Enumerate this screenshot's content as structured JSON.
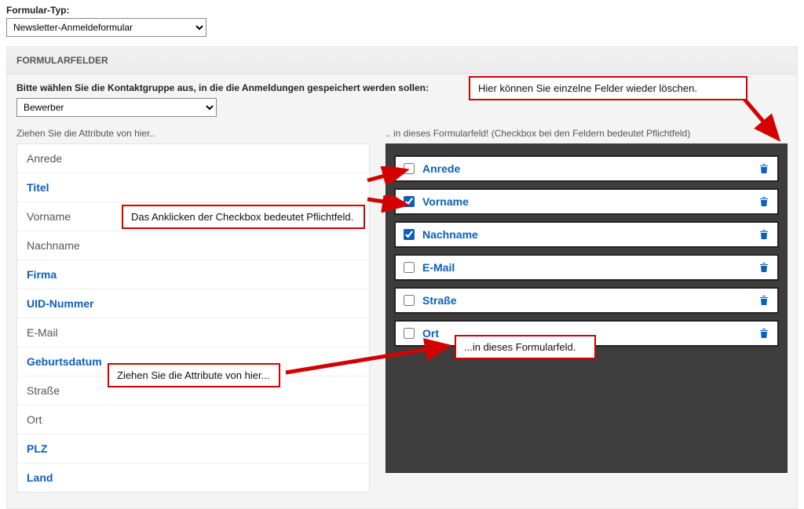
{
  "top": {
    "label": "Formular-Typ:",
    "selected": "Newsletter-Anmeldeformular"
  },
  "section": {
    "title": "FORMULARFELDER",
    "contact_prompt": "Bitte wählen Sie die Kontaktgruppe aus, in die die Anmeldungen gespeichert werden sollen:",
    "contact_selected": "Bewerber",
    "left_hint": "Ziehen Sie die Attribute von hier..",
    "right_hint": ".. in dieses Formularfeld! (Checkbox bei den Feldern bedeutet Pflichtfeld)"
  },
  "source_items": [
    {
      "label": "Anrede",
      "bold": false
    },
    {
      "label": "Titel",
      "bold": true
    },
    {
      "label": "Vorname",
      "bold": false
    },
    {
      "label": "Nachname",
      "bold": false
    },
    {
      "label": "Firma",
      "bold": true
    },
    {
      "label": "UID-Nummer",
      "bold": true
    },
    {
      "label": "E-Mail",
      "bold": false
    },
    {
      "label": "Geburtsdatum",
      "bold": true
    },
    {
      "label": "Straße",
      "bold": false
    },
    {
      "label": "Ort",
      "bold": false
    },
    {
      "label": "PLZ",
      "bold": true
    },
    {
      "label": "Land",
      "bold": true
    }
  ],
  "dest_items": [
    {
      "label": "Anrede",
      "checked": false
    },
    {
      "label": "Vorname",
      "checked": true
    },
    {
      "label": "Nachname",
      "checked": true
    },
    {
      "label": "E-Mail",
      "checked": false
    },
    {
      "label": "Straße",
      "checked": false
    },
    {
      "label": "Ort",
      "checked": false
    }
  ],
  "callouts": {
    "delete_hint": "Hier können Sie einzelne Felder wieder löschen.",
    "checkbox_hint": "Das Anklicken der Checkbox bedeutet Pflichtfeld.",
    "drag_hint": "Ziehen Sie die Attribute von hier...",
    "drop_hint": "...in dieses Formularfeld."
  }
}
